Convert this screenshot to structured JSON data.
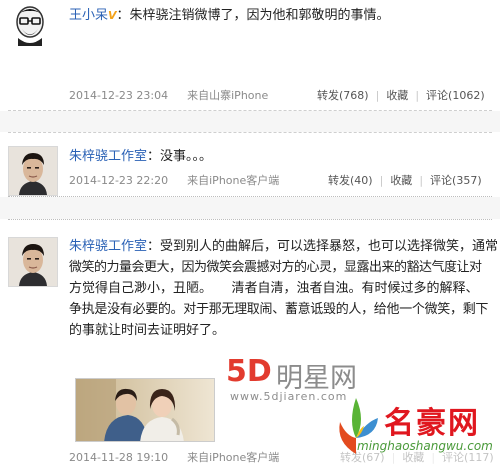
{
  "posts": [
    {
      "author": "王小呆",
      "verified_mark": "V",
      "separator": "：",
      "text": "朱梓骁注销微博了，因为他和郭敬明的事情。",
      "time": "2014-12-23 23:04",
      "source": "来自山寨iPhone",
      "repost": "转发(768)",
      "favorite": "收藏",
      "comment": "评论(1062)"
    },
    {
      "author": "朱梓骁工作室",
      "separator": "：",
      "text": "没事。。。",
      "time": "2014-12-23 22:20",
      "source": "来自iPhone客户端",
      "repost": "转发(40)",
      "favorite": "收藏",
      "comment": "评论(357)"
    },
    {
      "author": "朱梓骁工作室",
      "separator": "：",
      "lines": [
        "受到别人的曲解后，可以选择暴怒，也可以选择微笑，通常",
        "微笑的力量会更大，因为微笑会震撼对方的心灵，显露出来的豁达气度让对",
        "方觉得自己渺小，丑陋。　　清者自清，浊者自浊。有时候过多的解释、",
        "争执是没有必要的。对于那无理取闹、蓄意诋毁的人，给他一个微笑，剩下",
        "的事就让时间去证明好了。"
      ],
      "time": "2014-11-28 19:10",
      "source": "来自iPhone客户端",
      "repost": "转发(67)",
      "favorite": "收藏",
      "comment": "评论(117)"
    }
  ],
  "watermarks": {
    "star_brand_5d": "5D",
    "star_brand_cn": "明星网",
    "star_site": "www.5djiaren.com",
    "haoming_cn": "名豪网",
    "haoming_site": "minghaoshangwu.com"
  },
  "colors": {
    "link": "#2b62b6",
    "meta": "#8a8a8a",
    "brand_red": "#e0171f"
  }
}
